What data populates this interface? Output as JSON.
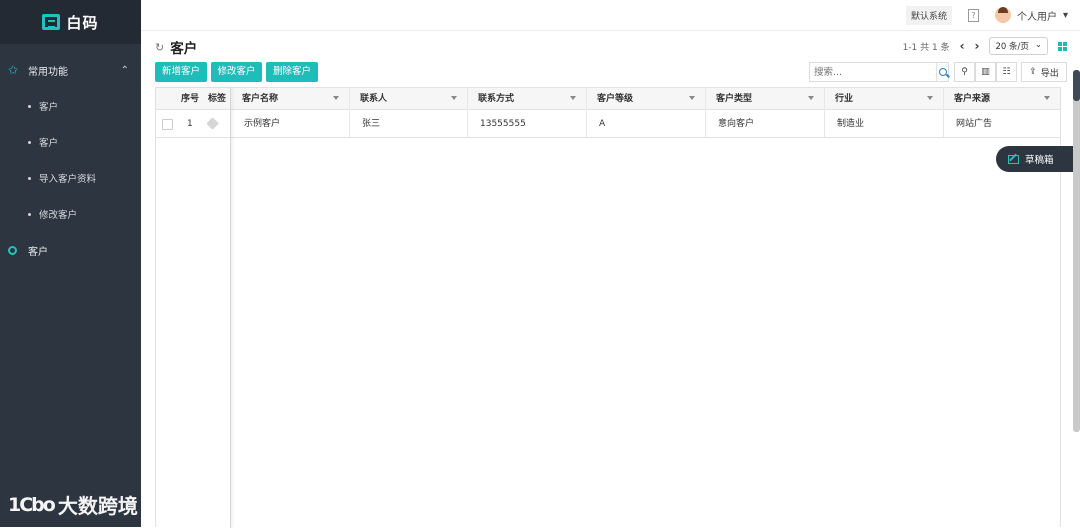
{
  "app": {
    "logo_text": "白码"
  },
  "sidebar": {
    "group_label": "常用功能",
    "items": [
      {
        "label": "客户"
      },
      {
        "label": "客户"
      },
      {
        "label": "导入客户资料"
      },
      {
        "label": "修改客户"
      }
    ],
    "top_item_label": "客户"
  },
  "watermark": {
    "glyph": "1Cbo",
    "text": "大数跨境"
  },
  "topbar": {
    "system_label": "默认系统",
    "help_glyph": "?",
    "user_label": "个人用户",
    "user_caret": "▾"
  },
  "page": {
    "title": "客户",
    "refresh_glyph": "↻"
  },
  "pager": {
    "summary": "1-1 共 1 条",
    "prev": "‹",
    "next": "›",
    "page_size": "20 条/页",
    "page_size_caret": "⌄"
  },
  "toolbar": {
    "add_label": "新增客户",
    "edit_label": "修改客户",
    "delete_label": "删除客户",
    "search_placeholder": "搜索...",
    "filter_glyph": "⚲",
    "chart_glyph": "▥",
    "settings_glyph": "☷",
    "export_glyph": "⇪",
    "export_label": "导出"
  },
  "table": {
    "frozen_headers": {
      "index": "序号",
      "tag": "标签"
    },
    "columns": [
      "客户名称",
      "联系人",
      "联系方式",
      "客户等级",
      "客户类型",
      "行业",
      "客户来源"
    ],
    "rows": [
      {
        "index": "1",
        "cells": [
          "示例客户",
          "张三",
          "13555555",
          "A",
          "意向客户",
          "制造业",
          "网站广告"
        ]
      }
    ]
  },
  "draft": {
    "label": "草稿箱"
  },
  "colors": {
    "accent": "#1fbdb9",
    "sidebar_bg": "#2d3540",
    "logo_bar_bg": "#232a33"
  }
}
